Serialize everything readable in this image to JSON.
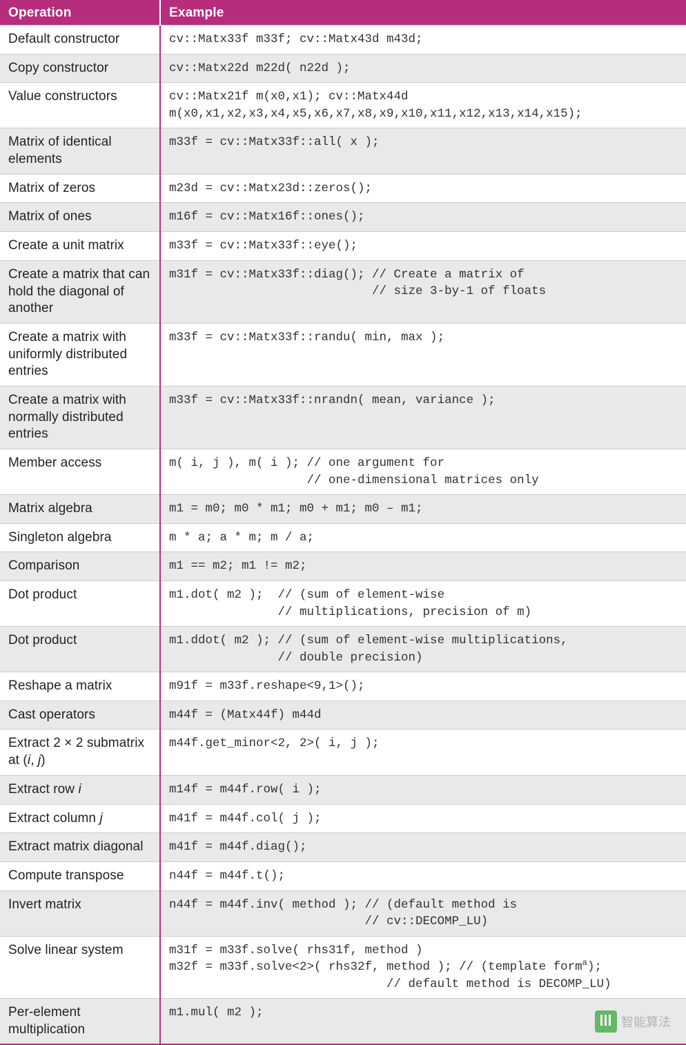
{
  "watermark": "智能算法",
  "table": {
    "headers": [
      "Operation",
      "Example"
    ],
    "rows": [
      {
        "shade": false,
        "op": "Default constructor",
        "ex": "cv::Matx33f m33f; cv::Matx43d m43d;"
      },
      {
        "shade": true,
        "op": "Copy constructor",
        "ex": "cv::Matx22d m22d( n22d );"
      },
      {
        "shade": false,
        "op": "Value constructors",
        "ex": "cv::Matx21f m(x0,x1); cv::Matx44d\nm(x0,x1,x2,x3,x4,x5,x6,x7,x8,x9,x10,x11,x12,x13,x14,x15);"
      },
      {
        "shade": true,
        "op": "Matrix of identical elements",
        "ex": "m33f = cv::Matx33f::all( x );"
      },
      {
        "shade": false,
        "op": "Matrix of zeros",
        "ex": "m23d = cv::Matx23d::zeros();"
      },
      {
        "shade": true,
        "op": "Matrix of ones",
        "ex": "m16f = cv::Matx16f::ones();"
      },
      {
        "shade": false,
        "op": "Create a unit matrix",
        "ex": "m33f = cv::Matx33f::eye();"
      },
      {
        "shade": true,
        "op": "Create a matrix that can hold the diagonal of another",
        "ex": "m31f = cv::Matx33f::diag(); // Create a matrix of\n                            // size 3-by-1 of floats"
      },
      {
        "shade": false,
        "op": "Create a matrix with uniformly distributed entries",
        "ex": "m33f = cv::Matx33f::randu( min, max );"
      },
      {
        "shade": true,
        "op": "Create a matrix with normally distributed entries",
        "ex": "m33f = cv::Matx33f::nrandn( mean, variance );"
      },
      {
        "shade": false,
        "op": "Member access",
        "ex": "m( i, j ), m( i ); // one argument for\n                   // one-dimensional matrices only"
      },
      {
        "shade": true,
        "op": "Matrix algebra",
        "ex": "m1 = m0; m0 * m1; m0 + m1; m0 – m1;"
      },
      {
        "shade": false,
        "op": "Singleton algebra",
        "ex": "m * a; a * m; m / a;"
      },
      {
        "shade": true,
        "op": "Comparison",
        "ex": "m1 == m2; m1 != m2;"
      },
      {
        "shade": false,
        "op": "Dot product",
        "ex": "m1.dot( m2 );  // (sum of element-wise\n               // multiplications, precision of m)"
      },
      {
        "shade": true,
        "op": "Dot product",
        "ex": "m1.ddot( m2 ); // (sum of element-wise multiplications,\n               // double precision)"
      },
      {
        "shade": false,
        "op": "Reshape a matrix",
        "ex": "m91f = m33f.reshape<9,1>();"
      },
      {
        "shade": true,
        "op": "Cast operators",
        "ex": "m44f = (Matx44f) m44d"
      },
      {
        "shade": false,
        "op_html": "Extract 2 × 2 submatrix at (<span class=\"ital\">i</span>, <span class=\"ital\">j</span>)",
        "ex": "m44f.get_minor<2, 2>( i, j );"
      },
      {
        "shade": true,
        "op_html": "Extract row <span class=\"ital\">i</span>",
        "ex": "m14f = m44f.row( i );"
      },
      {
        "shade": false,
        "op_html": "Extract column <span class=\"ital\">j</span>",
        "ex": "m41f = m44f.col( j );"
      },
      {
        "shade": true,
        "op": "Extract matrix diagonal",
        "ex": "m41f = m44f.diag();"
      },
      {
        "shade": false,
        "op": "Compute transpose",
        "ex": "n44f = m44f.t();"
      },
      {
        "shade": true,
        "op": "Invert matrix",
        "ex": "n44f = m44f.inv( method ); // (default method is\n                           // cv::DECOMP_LU)"
      },
      {
        "shade": false,
        "op": "Solve linear system",
        "ex_html": "m31f = m33f.solve( rhs31f, method )\nm32f = m33f.solve<2>( rhs32f, method ); // (template form<sup>a</sup>);\n                              // default method is DECOMP_LU)"
      },
      {
        "shade": true,
        "op": "Per-element multiplication",
        "ex": "m1.mul( m2 );"
      }
    ]
  }
}
